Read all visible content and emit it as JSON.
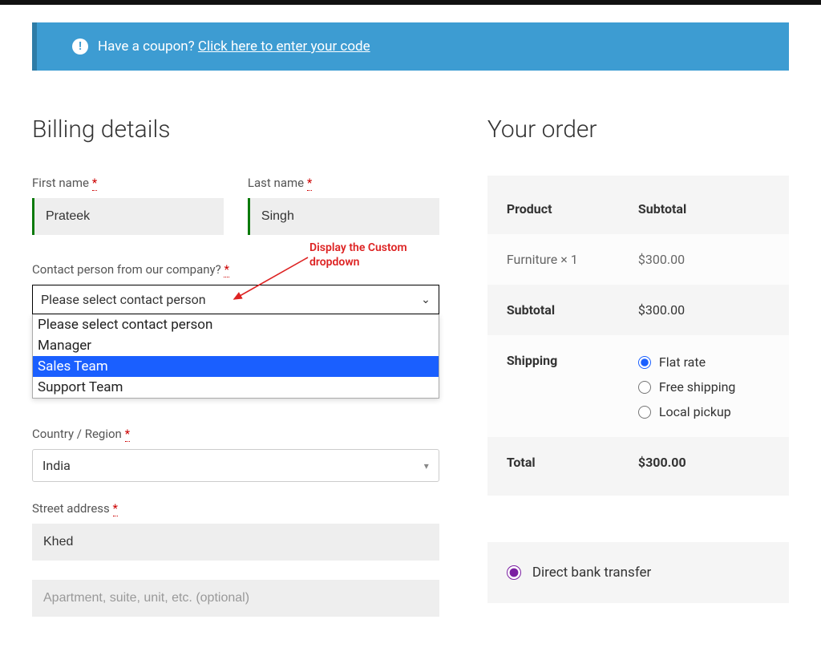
{
  "coupon": {
    "text": "Have a coupon?",
    "link": "Click here to enter your code"
  },
  "billing": {
    "title": "Billing details",
    "first_name_label": "First name",
    "first_name_value": "Prateek",
    "last_name_label": "Last name",
    "last_name_value": "Singh",
    "contact_label": "Contact person from our company?",
    "contact_selected": "Please select contact person",
    "contact_options": [
      "Please select contact person",
      "Manager",
      "Sales Team",
      "Support Team"
    ],
    "country_label": "Country / Region",
    "country_value": "India",
    "street_label": "Street address",
    "street_value": "Khed",
    "street2_placeholder": "Apartment, suite, unit, etc. (optional)"
  },
  "annotation": {
    "line1": "Display the Custom",
    "line2": "dropdown"
  },
  "order": {
    "title": "Your order",
    "header_product": "Product",
    "header_subtotal": "Subtotal",
    "item_name": "Furniture",
    "item_qty": "× 1",
    "item_price": "$300.00",
    "subtotal_label": "Subtotal",
    "subtotal_value": "$300.00",
    "shipping_label": "Shipping",
    "shipping_options": {
      "flat": "Flat rate",
      "free": "Free shipping",
      "local": "Local pickup"
    },
    "total_label": "Total",
    "total_value": "$300.00"
  },
  "payment": {
    "bank": "Direct bank transfer"
  }
}
